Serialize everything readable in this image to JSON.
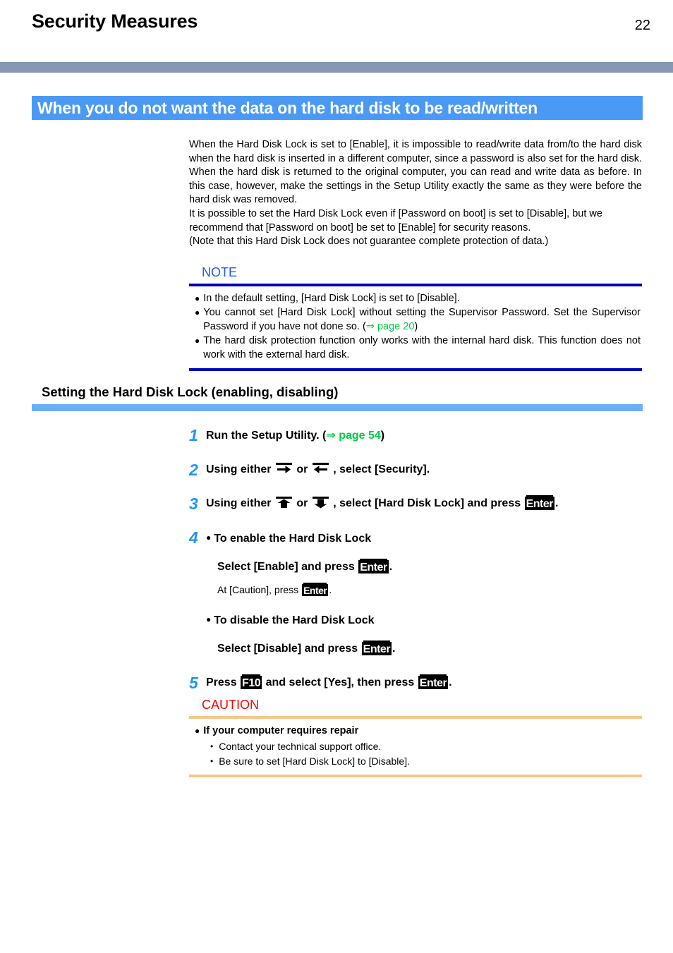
{
  "header": {
    "title": "Security Measures",
    "page_number": "22",
    "rule_color": "#8598b4"
  },
  "banner": {
    "text": "When you do not want the data on the hard disk to be read/written",
    "background": "#4a9af5",
    "text_color": "#ffffff"
  },
  "intro": {
    "paragraph_1": "When the Hard Disk Lock is set to [Enable], it is impossible to read/write data from/to the hard disk when the hard disk is inserted in a different computer, since a password is also set for the hard disk. When the hard disk is returned to the original computer, you can read and write data as before. In this case, however, make the settings in the Setup Utility exactly the same as they were before the hard disk was removed.",
    "paragraph_2": "It is possible to set the Hard Disk Lock even if [Password on boot] is set to [Disable], but we recommend that [Password on boot] be set to [Enable] for security reasons.",
    "paragraph_3": "(Note that this Hard Disk Lock does not guarantee complete protection of data.)"
  },
  "note": {
    "label": "NOTE",
    "label_color": "#1a5cf0",
    "rule_color": "#0000bb",
    "bullet_char": "●",
    "items": [
      {
        "text": "In the default setting, [Hard Disk Lock] is set to [Disable]."
      },
      {
        "text_before": "You cannot set [Hard Disk Lock] without setting the Supervisor Password. Set the Supervisor Password if you have not done so. (",
        "link_arrow": "⇒",
        "link_text": " page 20",
        "text_after": ")",
        "link_color": "#00cc44"
      },
      {
        "text": "The hard disk protection function only works with the internal hard disk.   This function does not work with the external hard disk."
      }
    ]
  },
  "section": {
    "title": "Setting the Hard Disk Lock (enabling, disabling)",
    "rule_color": "#6aaef7"
  },
  "steps": {
    "number_color": "#2196f3",
    "items": [
      {
        "num": "1",
        "text_before": "Run the Setup Utility. (",
        "link_arrow": "⇒",
        "link_text": " page 54",
        "text_after": ")"
      },
      {
        "num": "2",
        "text_before": "Using either ",
        "key_1": "right-arrow-key",
        "text_middle": " or ",
        "key_2": "left-arrow-key",
        "text_after": " , select [Security]."
      },
      {
        "num": "3",
        "text_before": "Using either ",
        "key_1": "up-arrow-key",
        "text_middle": " or ",
        "key_2": "down-arrow-key",
        "text_middle_2": " , select [Hard Disk Lock] and press ",
        "key_3": "Enter",
        "text_after": "."
      },
      {
        "num": "4",
        "bullet_char": "●",
        "enable_heading": "To enable the Hard Disk Lock",
        "enable_action_before": "Select [Enable] and press ",
        "enable_action_key": "Enter",
        "enable_action_after": ".",
        "enable_note_before": "At [Caution], press ",
        "enable_note_key": "Enter",
        "enable_note_after": ".",
        "disable_heading": "To disable the Hard Disk Lock",
        "disable_action_before": "Select [Disable] and press ",
        "disable_action_key": "Enter",
        "disable_action_after": "."
      },
      {
        "num": "5",
        "text_before": "Press ",
        "key_1": "F10",
        "text_middle": " and select [Yes], then press ",
        "key_2": "Enter",
        "text_after": "."
      }
    ]
  },
  "caution": {
    "label": "CAUTION",
    "label_color": "#ff0000",
    "rule_color": "#f5c78a",
    "bullet_char": "●",
    "heading": "If your computer requires repair",
    "sub_bullet_char": "•",
    "sub_items": [
      "Contact your technical support office.",
      "Be sure to set [Hard Disk Lock] to [Disable]."
    ]
  }
}
